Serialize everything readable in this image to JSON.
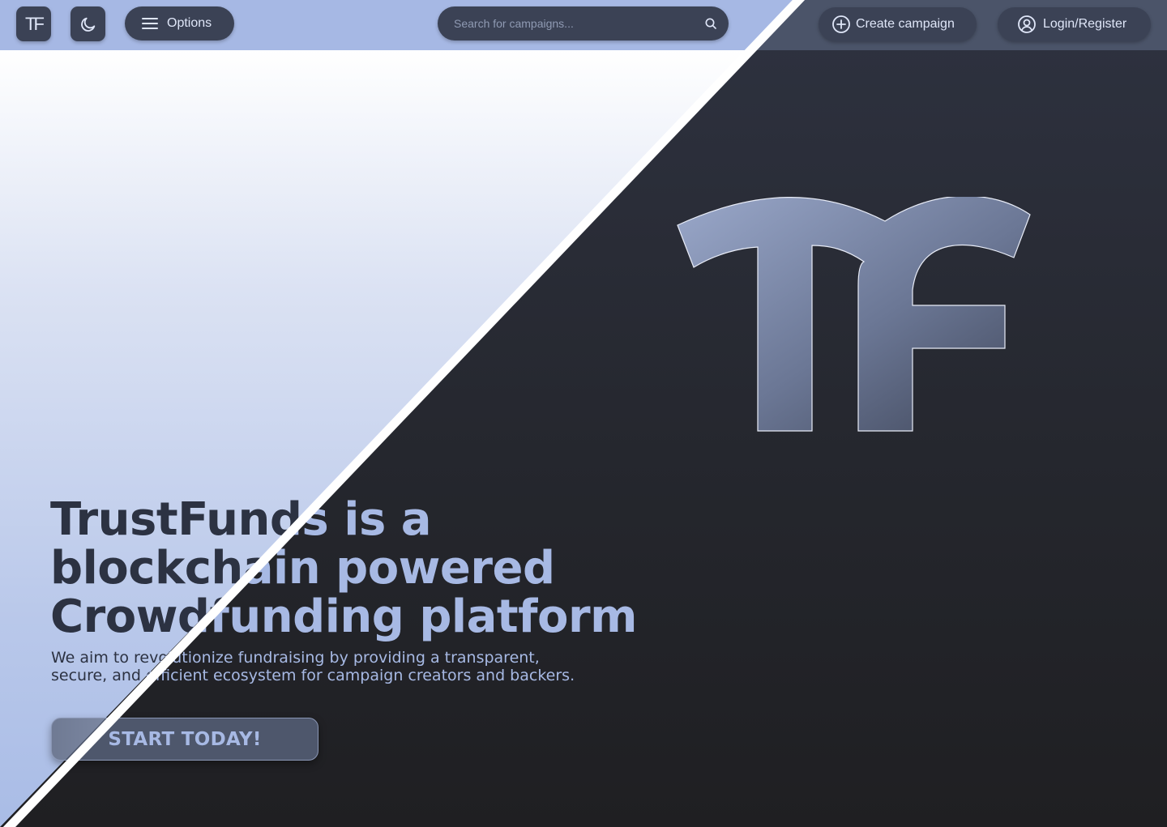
{
  "header": {
    "logo_text": "TF",
    "theme_toggle": "moon-icon",
    "options_label": "Options",
    "search_placeholder": "Search for campaigns...",
    "create_label": "Create campaign",
    "login_label": "Login/Register"
  },
  "hero": {
    "title_line1": "TrustFunds is a",
    "title_line2": "blockchain powered",
    "title_line3": "Crowdfunding platform",
    "subtitle_line1": "We aim to revolutionize fundraising by providing a transparent,",
    "subtitle_line2": "secure, and efficient ecosystem for campaign creators and backers.",
    "cta_label": "START TODAY!"
  },
  "colors": {
    "accent_light": "#a7b9e4",
    "dark_text": "#2c3242",
    "button_bg": "#3b4255"
  }
}
